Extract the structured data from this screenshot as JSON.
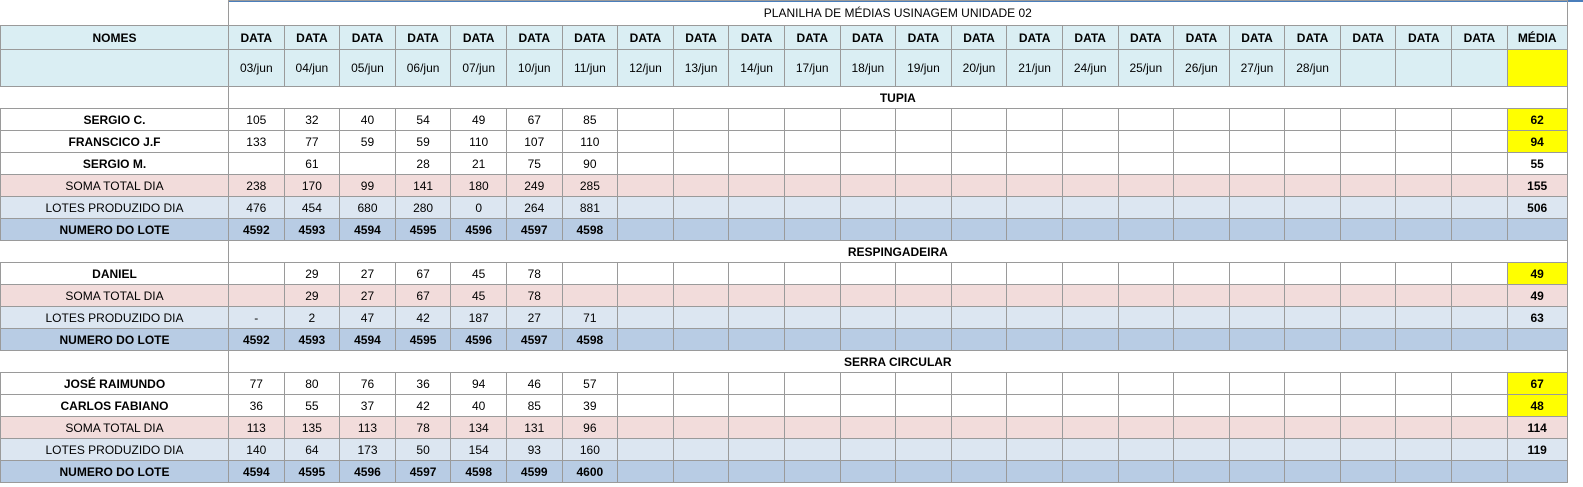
{
  "title": "PLANILHA DE MÉDIAS USINAGEM UNIDADE 02",
  "header": {
    "names_label": "NOMES",
    "data_label": "DATA",
    "media_label": "MÉDIA",
    "dates": [
      "03/jun",
      "04/jun",
      "05/jun",
      "06/jun",
      "07/jun",
      "10/jun",
      "11/jun",
      "12/jun",
      "13/jun",
      "14/jun",
      "17/jun",
      "18/jun",
      "19/jun",
      "20/jun",
      "21/jun",
      "24/jun",
      "25/jun",
      "26/jun",
      "27/jun",
      "28/jun",
      "",
      "",
      ""
    ]
  },
  "sections": [
    {
      "name": "TUPIA",
      "people": [
        {
          "name": "SERGIO C.",
          "values": [
            "105",
            "32",
            "40",
            "54",
            "49",
            "67",
            "85"
          ],
          "mean": "62",
          "highlight": true
        },
        {
          "name": "FRANSCICO J.F",
          "values": [
            "133",
            "77",
            "59",
            "59",
            "110",
            "107",
            "110"
          ],
          "mean": "94",
          "highlight": true
        },
        {
          "name": "SERGIO M.",
          "values": [
            "",
            "61",
            "",
            "28",
            "21",
            "75",
            "90"
          ],
          "mean": "55",
          "highlight": false
        }
      ],
      "soma": {
        "label": "SOMA TOTAL DIA",
        "values": [
          "238",
          "170",
          "99",
          "141",
          "180",
          "249",
          "285"
        ],
        "mean": "155"
      },
      "lotes": {
        "label": "LOTES PRODUZIDO DIA",
        "values": [
          "476",
          "454",
          "680",
          "280",
          "0",
          "264",
          "881"
        ],
        "mean": "506"
      },
      "numero": {
        "label": "NUMERO DO LOTE",
        "values": [
          "4592",
          "4593",
          "4594",
          "4595",
          "4596",
          "4597",
          "4598"
        ],
        "mean": ""
      }
    },
    {
      "name": "RESPINGADEIRA",
      "people": [
        {
          "name": "DANIEL",
          "values": [
            "",
            "29",
            "27",
            "67",
            "45",
            "78",
            ""
          ],
          "mean": "49",
          "highlight": true
        }
      ],
      "soma": {
        "label": "SOMA TOTAL DIA",
        "values": [
          "",
          "29",
          "27",
          "67",
          "45",
          "78",
          ""
        ],
        "mean": "49"
      },
      "lotes": {
        "label": "LOTES PRODUZIDO DIA",
        "values": [
          "-",
          "2",
          "47",
          "42",
          "187",
          "27",
          "71"
        ],
        "mean": "63"
      },
      "numero": {
        "label": "NUMERO DO LOTE",
        "values": [
          "4592",
          "4593",
          "4594",
          "4595",
          "4596",
          "4597",
          "4598"
        ],
        "mean": ""
      }
    },
    {
      "name": "SERRA CIRCULAR",
      "people": [
        {
          "name": "JOSÉ RAIMUNDO",
          "values": [
            "77",
            "80",
            "76",
            "36",
            "94",
            "46",
            "57"
          ],
          "mean": "67",
          "highlight": true
        },
        {
          "name": "CARLOS FABIANO",
          "values": [
            "36",
            "55",
            "37",
            "42",
            "40",
            "85",
            "39"
          ],
          "mean": "48",
          "highlight": true
        }
      ],
      "soma": {
        "label": "SOMA TOTAL DIA",
        "values": [
          "113",
          "135",
          "113",
          "78",
          "134",
          "131",
          "96"
        ],
        "mean": "114"
      },
      "lotes": {
        "label": "LOTES PRODUZIDO DIA",
        "values": [
          "140",
          "64",
          "173",
          "50",
          "154",
          "93",
          "160"
        ],
        "mean": "119"
      },
      "numero": {
        "label": "NUMERO DO LOTE",
        "values": [
          "4594",
          "4595",
          "4596",
          "4597",
          "4598",
          "4599",
          "4600"
        ],
        "mean": ""
      }
    }
  ],
  "colors": {
    "header_bg": "#daeef3",
    "soma_bg": "#f2dcdb",
    "lotes_bg": "#dce6f1",
    "numero_bg": "#b8cce4",
    "highlight": "#ffff00"
  }
}
